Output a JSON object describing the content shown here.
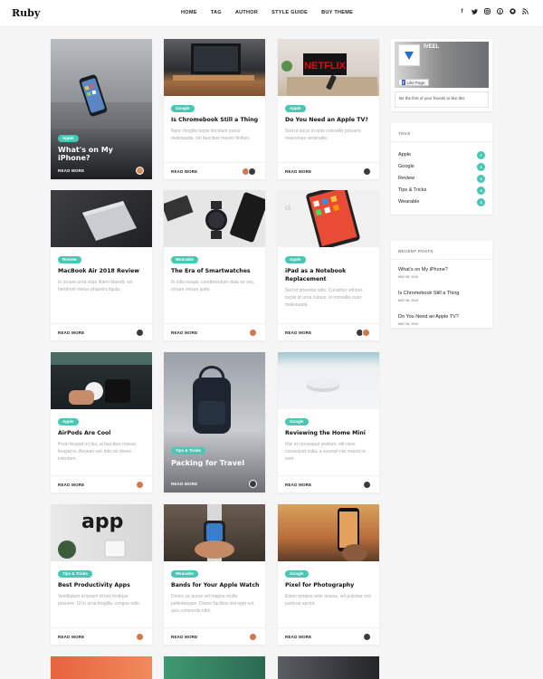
{
  "brand": {
    "logo": "Ruby"
  },
  "nav": [
    "HOME",
    "TAG",
    "AUTHOR",
    "STYLE GUIDE",
    "BUY THEME"
  ],
  "social_icons": [
    "facebook-icon",
    "twitter-icon",
    "instagram-icon",
    "pinterest-icon",
    "github-icon",
    "rss-icon"
  ],
  "colors": {
    "accent": "#45c9b5"
  },
  "read_more": "READ MORE",
  "posts": [
    {
      "tag": "Apple",
      "title": "What's on My iPhone?",
      "desc": ""
    },
    {
      "tag": "Google",
      "title": "Is Chromebook Still a Thing",
      "desc": "Nunc fringilla turpis tincidunt purus malesuada, vel faucibus mauris finibus."
    },
    {
      "tag": "Apple",
      "title": "Do You Need an Apple TV?",
      "desc": "Sed ut lacus id ante convallis posuere maecenas venenatis."
    },
    {
      "tag": "Review",
      "title": "MacBook Air 2018 Review",
      "desc": "In ornare urna vitae libero blandit, vel hendrerit metus pharetra ligula."
    },
    {
      "tag": "Wearable",
      "title": "The Era of Smartwatches",
      "desc": "In odio neque, condimentum vitae ex nec, ornare ornare justo."
    },
    {
      "tag": "Apple",
      "title": "iPad as a Notebook Replacement",
      "desc": "Sed id pharetra odio. Curabitur ultrices turpis at urna cursus, et convallis nunc malesuada."
    },
    {
      "tag": "Apple",
      "title": "AirPods Are Cool",
      "desc": "Proin feugiat mi dui, ut faucibus massa feugiat in. Aenean nec felis mi donec interdum."
    },
    {
      "tag": "Tips & Tricks",
      "title": "Packing for Travel",
      "desc": ""
    },
    {
      "tag": "Google",
      "title": "Reviewing the Home Mini",
      "desc": "Nisi et consequat pretium, elit risus consequat nulla, a suscipit nisi mauris in sem."
    },
    {
      "tag": "Tips & Tricks",
      "title": "Best Productivity Apps",
      "desc": "Vestibulum id ipsum id nisi tristique posuere. Ut in urna fringilla, congue odio."
    },
    {
      "tag": "Wearable",
      "title": "Bands for Your Apple Watch",
      "desc": "Donec ac purus vel magna mollis pellentesque. Donec facilisis nisl eget est, quis commodo nibh."
    },
    {
      "tag": "Google",
      "title": "Pixel for Photography",
      "desc": "Etiam tempus ante massa, vel pulvinar orci pulvinar ayctor."
    }
  ],
  "fb_widget": {
    "name": "IVEEL",
    "like_label": "Like Page",
    "cta": "Be the first of your friends to like this"
  },
  "tags_widget": {
    "title": "TAGS",
    "items": [
      {
        "name": "Apple",
        "count": "7"
      },
      {
        "name": "Google",
        "count": "3"
      },
      {
        "name": "Review",
        "count": "3"
      },
      {
        "name": "Tips & Tricks",
        "count": "3"
      },
      {
        "name": "Wearable",
        "count": "3"
      }
    ]
  },
  "recent_widget": {
    "title": "RECENT POSTS",
    "items": [
      {
        "title": "What's on My iPhone?",
        "date": "MAY 06, 2019"
      },
      {
        "title": "Is Chromebook Still a Thing",
        "date": "MAY 06, 2019"
      },
      {
        "title": "Do You Need an Apple TV?",
        "date": "MAY 06, 2019"
      }
    ]
  }
}
